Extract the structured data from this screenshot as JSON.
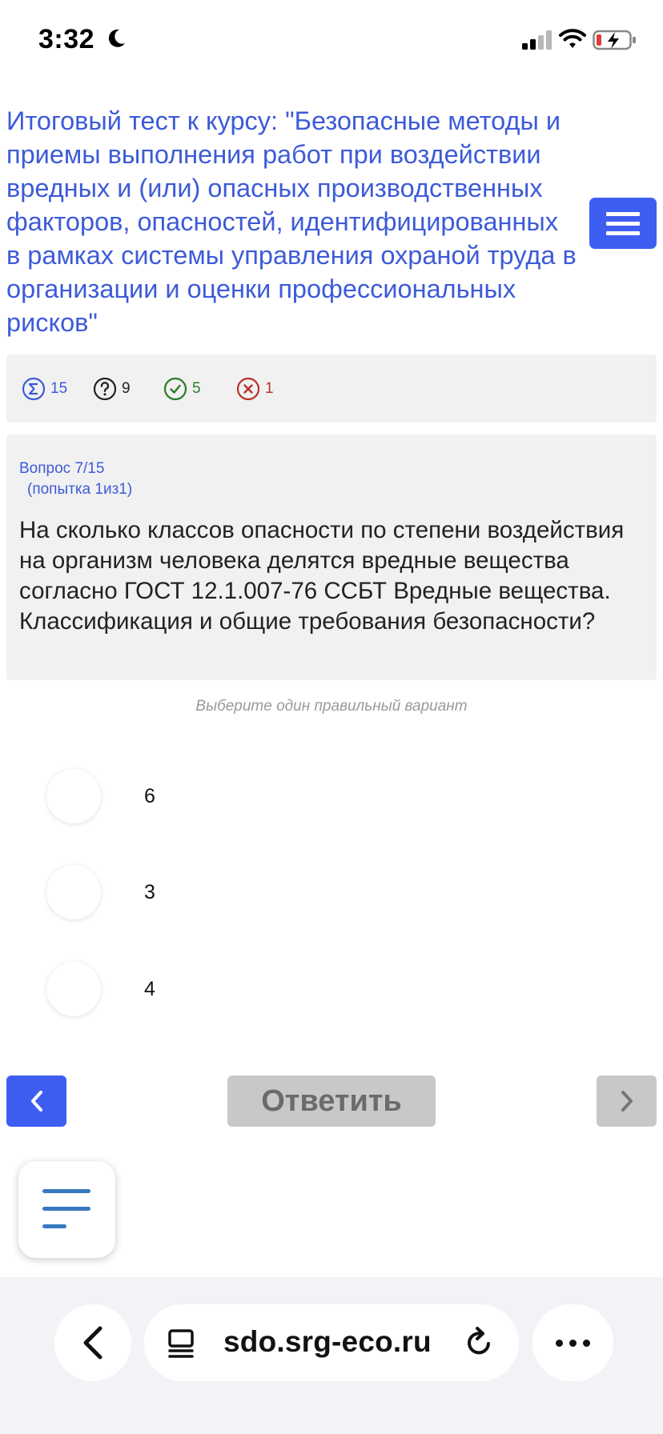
{
  "status_bar": {
    "time": "3:32",
    "icons": [
      "moon-icon",
      "cellular-signal-icon",
      "wifi-icon",
      "battery-charging-icon"
    ]
  },
  "header": {
    "course_title": " Итоговый тест к курсу: \"Безопасные методы и приемы выполнения работ при воздействии вредных и (или) опасных производственных факторов, опасностей, идентифицированных в рамках системы управления охраной труда в организации и оценки профессиональных рисков\"",
    "menu_icon": "hamburger-icon"
  },
  "stats": {
    "total": "15",
    "unanswered": "9",
    "correct": "5",
    "wrong": "1",
    "colors": {
      "total": "#3d5bd8",
      "unanswered": "#222222",
      "correct": "#2a7b2a",
      "wrong": "#b8322c"
    }
  },
  "question": {
    "number": "Вопрос 7/15",
    "attempt": "(попытка 1из1)",
    "text": "На сколько классов опасности по степени воздействия на организм человека делятся вредные вещества согласно ГОСТ 12.1.007-76 ССБТ Вредные вещества. Классификация и общие требования безопасности?"
  },
  "hint": "Выберите один правильный вариант",
  "answers": [
    {
      "label": "6"
    },
    {
      "label": "3"
    },
    {
      "label": "4"
    }
  ],
  "navigation": {
    "submit_label": "Ответить",
    "prev_icon": "chevron-left-icon",
    "next_icon": "chevron-right-icon"
  },
  "browser": {
    "url": "sdo.srg-eco.ru",
    "icons": [
      "back-arrow-icon",
      "reader-icon",
      "reload-icon",
      "more-icon"
    ]
  },
  "colors": {
    "accent": "#3e5ef2",
    "title": "#3d5bd8",
    "disabled": "#c8c8c8",
    "panel": "#f1f1f1"
  }
}
